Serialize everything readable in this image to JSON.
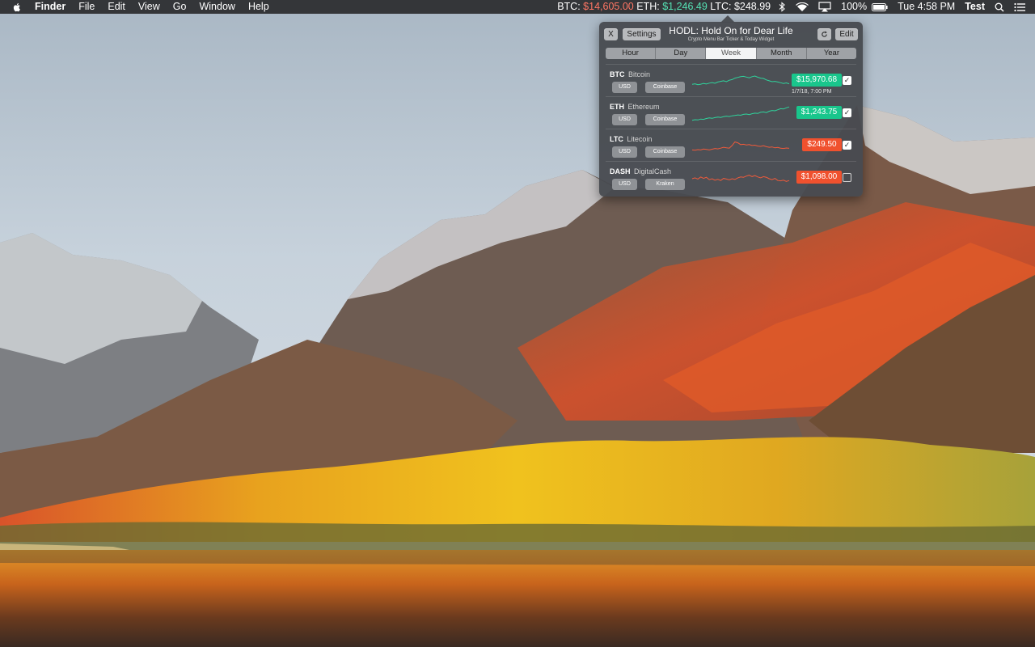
{
  "menubar": {
    "app_name": "Finder",
    "menus": [
      "File",
      "Edit",
      "View",
      "Go",
      "Window",
      "Help"
    ],
    "ticker": [
      {
        "symbol": "BTC:",
        "value": "$14,605.00",
        "trend": "down"
      },
      {
        "symbol": "ETH:",
        "value": "$1,246.49",
        "trend": "up"
      },
      {
        "symbol": "LTC:",
        "value": "$248.99",
        "trend": "neutral"
      }
    ],
    "battery": "100%",
    "clock": "Tue 4:58 PM",
    "user": "Test",
    "icons": [
      "bluetooth-icon",
      "wifi-icon",
      "airplay-icon",
      "battery-icon",
      "spotlight-search-icon",
      "notification-center-icon"
    ]
  },
  "panel": {
    "close_label": "X",
    "settings_label": "Settings",
    "title": "HODL: Hold On for Dear Life",
    "subtitle": "Crypto Menu Bar Ticker & Today Widget",
    "edit_label": "Edit",
    "refresh_icon": "refresh-icon",
    "tabs": [
      {
        "label": "Hour",
        "active": false
      },
      {
        "label": "Day",
        "active": false
      },
      {
        "label": "Week",
        "active": true
      },
      {
        "label": "Month",
        "active": false
      },
      {
        "label": "Year",
        "active": false
      }
    ],
    "coins": [
      {
        "ticker": "BTC",
        "name": "Bitcoin",
        "currency": "USD",
        "exchange": "Coinbase",
        "price": "$15,970.68",
        "trend": "up",
        "checked": true,
        "timestamp": "1/7/18, 7:00 PM",
        "spark": [
          0.35,
          0.38,
          0.33,
          0.36,
          0.4,
          0.37,
          0.42,
          0.45,
          0.41,
          0.48,
          0.52,
          0.55,
          0.5,
          0.58,
          0.62,
          0.7,
          0.74,
          0.78,
          0.8,
          0.76,
          0.72,
          0.78,
          0.82,
          0.75,
          0.7,
          0.68,
          0.6,
          0.55,
          0.5,
          0.52,
          0.48,
          0.44,
          0.4,
          0.43,
          0.38
        ]
      },
      {
        "ticker": "ETH",
        "name": "Ethereum",
        "currency": "USD",
        "exchange": "Coinbase",
        "price": "$1,243.75",
        "trend": "up",
        "checked": true,
        "timestamp": "",
        "spark": [
          0.15,
          0.18,
          0.17,
          0.22,
          0.2,
          0.25,
          0.28,
          0.26,
          0.3,
          0.33,
          0.31,
          0.35,
          0.38,
          0.36,
          0.4,
          0.42,
          0.45,
          0.43,
          0.48,
          0.5,
          0.47,
          0.52,
          0.55,
          0.53,
          0.6,
          0.62,
          0.58,
          0.66,
          0.7,
          0.68,
          0.74,
          0.8,
          0.78,
          0.85,
          0.9
        ]
      },
      {
        "ticker": "LTC",
        "name": "Litecoin",
        "currency": "USD",
        "exchange": "Coinbase",
        "price": "$249.50",
        "trend": "down",
        "checked": true,
        "timestamp": "",
        "spark": [
          0.3,
          0.28,
          0.32,
          0.3,
          0.35,
          0.33,
          0.3,
          0.34,
          0.38,
          0.36,
          0.4,
          0.45,
          0.42,
          0.4,
          0.55,
          0.75,
          0.7,
          0.6,
          0.62,
          0.58,
          0.6,
          0.55,
          0.57,
          0.52,
          0.5,
          0.54,
          0.48,
          0.45,
          0.47,
          0.42,
          0.44,
          0.4,
          0.38,
          0.41,
          0.39
        ]
      },
      {
        "ticker": "DASH",
        "name": "DigitalCash",
        "currency": "USD",
        "exchange": "Kraken",
        "price": "$1,098.00",
        "trend": "down",
        "checked": false,
        "timestamp": "",
        "spark": [
          0.5,
          0.55,
          0.48,
          0.6,
          0.52,
          0.58,
          0.45,
          0.5,
          0.42,
          0.47,
          0.4,
          0.52,
          0.48,
          0.44,
          0.5,
          0.46,
          0.55,
          0.6,
          0.58,
          0.65,
          0.7,
          0.62,
          0.68,
          0.6,
          0.55,
          0.62,
          0.58,
          0.5,
          0.45,
          0.52,
          0.4,
          0.38,
          0.42,
          0.35,
          0.4
        ]
      }
    ]
  },
  "colors": {
    "up": "#19c68c",
    "down": "#f0512e",
    "spark_up": "#2fd39c",
    "spark_down": "#f05a3a"
  }
}
